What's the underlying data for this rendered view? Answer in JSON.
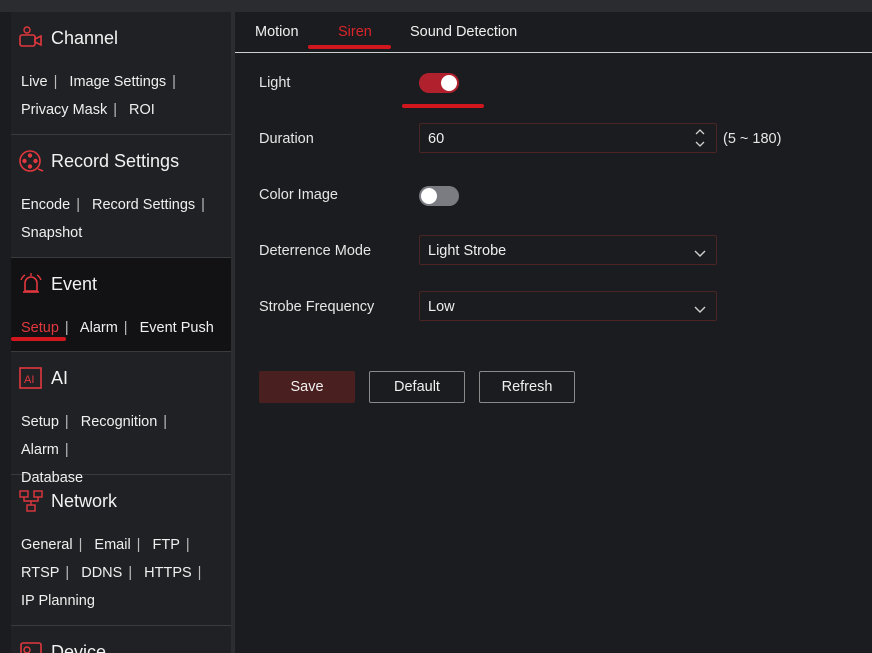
{
  "colors": {
    "accent": "#d2161e",
    "toggle_on": "#b0202d",
    "save_bg": "#4a1f1f"
  },
  "sidebar": {
    "sections": [
      {
        "title": "Channel",
        "icon": "camera-icon",
        "links": [
          "Live",
          "Image Settings",
          "Privacy Mask",
          "ROI"
        ]
      },
      {
        "title": "Record Settings",
        "icon": "film-reel-icon",
        "links": [
          "Encode",
          "Record Settings",
          "Snapshot"
        ]
      },
      {
        "title": "Event",
        "icon": "alarm-bell-icon",
        "links": [
          "Setup",
          "Alarm",
          "Event Push"
        ],
        "active_link": "Setup"
      },
      {
        "title": "AI",
        "icon": "ai-icon",
        "links": [
          "Setup",
          "Recognition",
          "Alarm",
          "Database"
        ]
      },
      {
        "title": "Network",
        "icon": "network-icon",
        "links": [
          "General",
          "Email",
          "FTP",
          "RTSP",
          "DDNS",
          "HTTPS",
          "IP Planning"
        ]
      },
      {
        "title": "Device",
        "icon": "device-icon",
        "links": []
      }
    ]
  },
  "tabs": [
    {
      "label": "Motion",
      "active": false
    },
    {
      "label": "Siren",
      "active": true
    },
    {
      "label": "Sound Detection",
      "active": false
    }
  ],
  "form": {
    "light": {
      "label": "Light",
      "on": true
    },
    "duration": {
      "label": "Duration",
      "value": "60",
      "range": "(5 ~ 180)"
    },
    "color_image": {
      "label": "Color Image",
      "on": false
    },
    "deterrence_mode": {
      "label": "Deterrence Mode",
      "value": "Light Strobe"
    },
    "strobe_frequency": {
      "label": "Strobe Frequency",
      "value": "Low"
    }
  },
  "buttons": {
    "save": "Save",
    "default": "Default",
    "refresh": "Refresh"
  }
}
